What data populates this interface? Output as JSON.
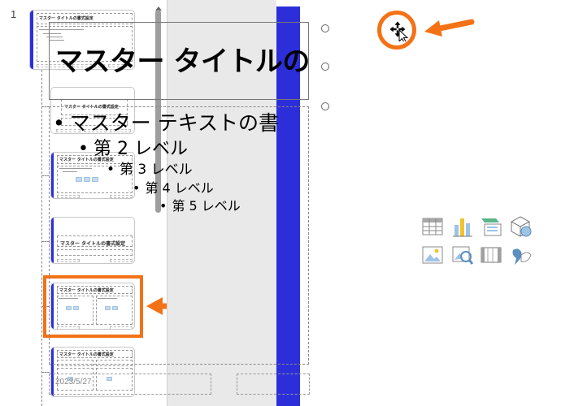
{
  "thumbnail_pane": {
    "slide_number": "1",
    "thumb_title_text": "マスター タイトルの書式設定",
    "selected_index": 4
  },
  "slide": {
    "title": "マスター タイトルの",
    "bullets": [
      "マスター テキストの書",
      "第 2 レベル",
      "第 3 レベル",
      "第 4 レベル",
      "第 5 レベル"
    ],
    "bullet_mark": "•",
    "date": "2023/5/27",
    "insert_icons": [
      "table-icon",
      "chart-icon",
      "smartart-icon",
      "3d-model-icon",
      "picture-icon",
      "online-picture-icon",
      "video-icon",
      "icons-icon"
    ]
  },
  "annotations": {
    "highlight_color": "#f47216"
  },
  "colors": {
    "accent": "#2c2fd9",
    "annotation": "#f47216",
    "gap_bg": "#e9e9e9"
  }
}
